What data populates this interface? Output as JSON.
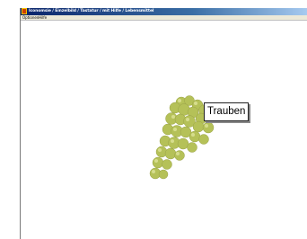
{
  "window": {
    "title": "Iconomsie / Einzelbild / Tastatur / mit Hilfe / Lebensmittel"
  },
  "menu": {
    "items": [
      {
        "label": "Optionen"
      },
      {
        "label": "Hilfe"
      }
    ]
  },
  "card": {
    "image": "grapes-image",
    "word": "Trauben"
  },
  "colors": {
    "title_bar_start": "#0a246a",
    "title_bar_end": "#a6caf0",
    "grape": "#b7c35a"
  }
}
